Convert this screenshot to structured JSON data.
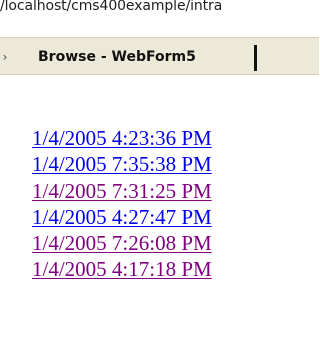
{
  "address_bar": {
    "url_fragment": "/localhost/cms400example/intra"
  },
  "tab": {
    "title": "Browse - WebForm5",
    "arrow_glyph": "›"
  },
  "links": [
    {
      "label": "1/4/2005 4:23:36 PM",
      "state": "unvisited",
      "color": "#0000ee"
    },
    {
      "label": "1/4/2005 7:35:38 PM",
      "state": "unvisited",
      "color": "#0000ee"
    },
    {
      "label": "1/4/2005 7:31:25 PM",
      "state": "visited",
      "color": "#800080"
    },
    {
      "label": "1/4/2005 4:27:47 PM",
      "state": "unvisited",
      "color": "#0000ee"
    },
    {
      "label": "1/4/2005 7:26:08 PM",
      "state": "visited",
      "color": "#800080"
    },
    {
      "label": "1/4/2005 4:17:18 PM",
      "state": "visited",
      "color": "#800080"
    }
  ],
  "colors": {
    "unvisited_link": "#0000ee",
    "visited_link": "#800080",
    "tab_background": "#ece9d8"
  }
}
